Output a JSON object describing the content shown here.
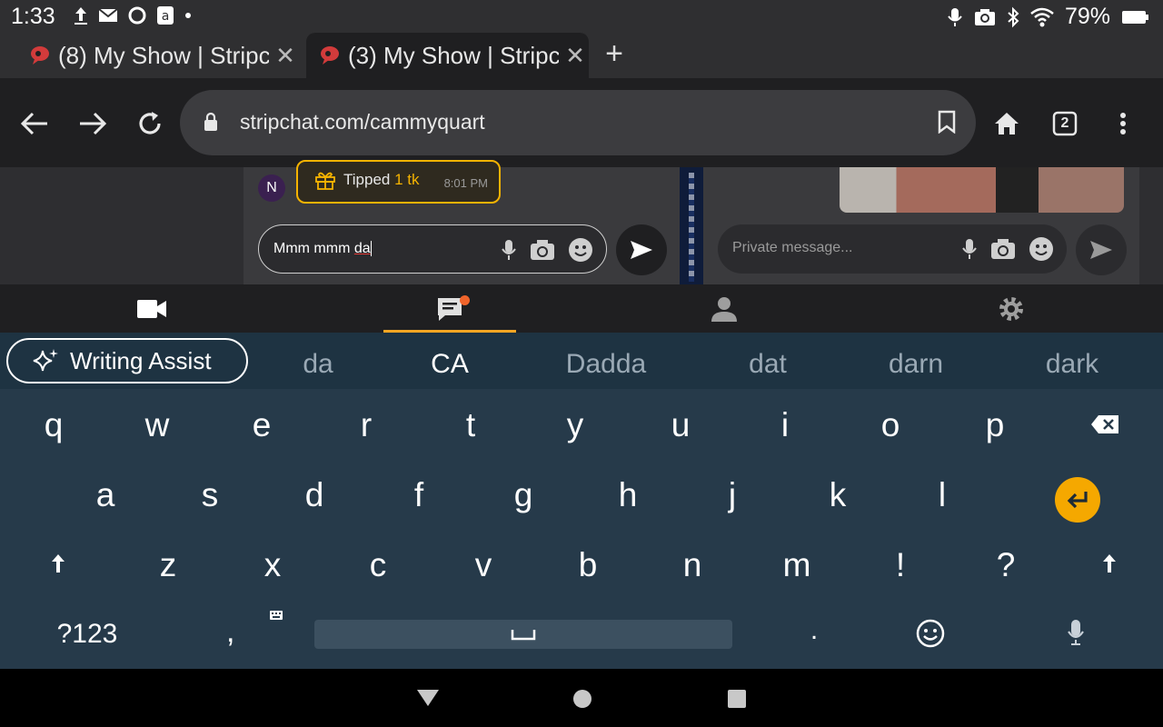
{
  "status_bar": {
    "time": "1:33",
    "battery": "79%"
  },
  "tabs": [
    {
      "title": "(8) My Show | Stripchat",
      "active": false
    },
    {
      "title": "(3) My Show | Stripchat",
      "active": true
    }
  ],
  "toolbar": {
    "url": "stripchat.com/cammyquart",
    "tab_count": "2"
  },
  "chat": {
    "avatar_initial": "N",
    "tip_label": "Tipped",
    "tip_amount": "1 tk",
    "tip_time": "8:01 PM",
    "input_prefix": "Mmm mmm ",
    "input_word": "da"
  },
  "private_chat": {
    "placeholder": "Private message..."
  },
  "app_nav": {
    "items": [
      "video",
      "chat",
      "profile",
      "settings"
    ],
    "active": "chat"
  },
  "keyboard": {
    "assist_label": "Writing Assist",
    "suggestions": [
      "da",
      "CA",
      "Dadda",
      "dat",
      "darn",
      "dark"
    ],
    "row1": [
      "q",
      "w",
      "e",
      "r",
      "t",
      "y",
      "u",
      "i",
      "o",
      "p"
    ],
    "row2": [
      "a",
      "s",
      "d",
      "f",
      "g",
      "h",
      "j",
      "k",
      "l"
    ],
    "row3": [
      "z",
      "x",
      "c",
      "v",
      "b",
      "n",
      "m",
      "!",
      "?"
    ],
    "symbols_label": "?123",
    "comma": ",",
    "period": "."
  },
  "colors": {
    "accent": "#f5a623",
    "enter_key": "#f5a800",
    "tip_border": "#f5b301",
    "keyboard_bg": "#263a4a"
  }
}
